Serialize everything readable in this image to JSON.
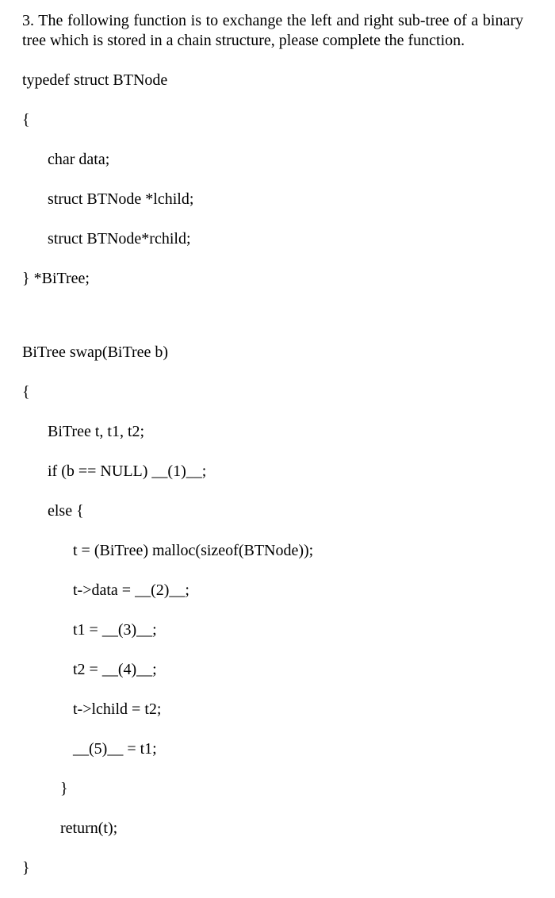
{
  "question": {
    "number": "3.",
    "prompt_part1": "The following function is to exchange the left and right sub-tree",
    "prompt_part2": "of a binary tree which is stored in a chain structure, please",
    "prompt_part3": "complete the function."
  },
  "typedef": {
    "line1": "typedef struct BTNode",
    "line2": "{",
    "line3": "char data;",
    "line4": "struct BTNode *lchild;",
    "line5": "struct BTNode*rchild;",
    "line6": "} *BiTree;"
  },
  "func": {
    "sig": "BiTree swap(BiTree b)",
    "open": "{",
    "decl": "BiTree t, t1, t2;",
    "ifline": "if (b == NULL) __(1)__;",
    "elseline": "else {",
    "malloc": "t = (BiTree) malloc(sizeof(BTNode));",
    "tdata": "t->data = __(2)__;",
    "t1line": "t1 = __(3)__;",
    "t2line": "t2 = __(4)__;",
    "lchild": "t->lchild = t2;",
    "blank5": "__(5)__ = t1;",
    "closeelse": "}",
    "ret": "return(t);",
    "close": "}"
  }
}
